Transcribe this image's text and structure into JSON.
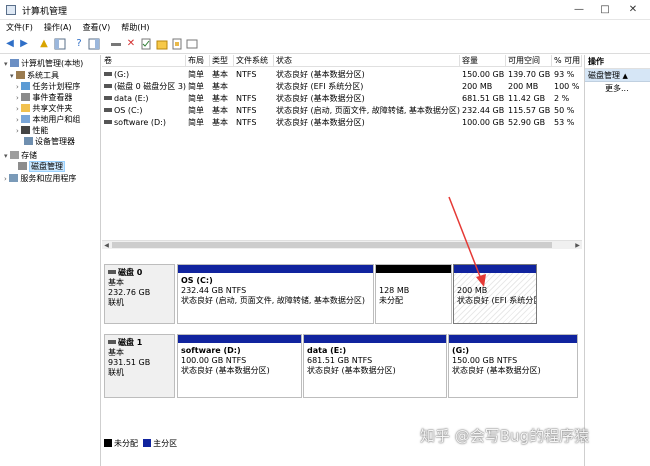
{
  "window": {
    "title": "计算机管理"
  },
  "menu": [
    "文件(F)",
    "操作(A)",
    "查看(V)",
    "帮助(H)"
  ],
  "tree": {
    "root": "计算机管理(本地)",
    "system_tools": "系统工具",
    "task_scheduler": "任务计划程序",
    "event_viewer": "事件查看器",
    "shared_folders": "共享文件夹",
    "local_users": "本地用户和组",
    "performance": "性能",
    "device_manager": "设备管理器",
    "storage": "存储",
    "disk_management": "磁盘管理",
    "services": "服务和应用程序"
  },
  "volumes": {
    "headers": [
      "卷",
      "布局",
      "类型",
      "文件系统",
      "状态",
      "容量",
      "可用空间",
      "% 可用"
    ],
    "rows": [
      [
        "(G:)",
        "简单",
        "基本",
        "NTFS",
        "状态良好 (基本数据分区)",
        "150.00 GB",
        "139.70 GB",
        "93 %"
      ],
      [
        "(磁盘 0 磁盘分区 3)",
        "简单",
        "基本",
        "",
        "状态良好 (EFI 系统分区)",
        "200 MB",
        "200 MB",
        "100 %"
      ],
      [
        "data (E:)",
        "简单",
        "基本",
        "NTFS",
        "状态良好 (基本数据分区)",
        "681.51 GB",
        "11.42 GB",
        "2 %"
      ],
      [
        "OS (C:)",
        "简单",
        "基本",
        "NTFS",
        "状态良好 (启动, 页面文件, 故障转储, 基本数据分区)",
        "232.44 GB",
        "115.57 GB",
        "50 %"
      ],
      [
        "software (D:)",
        "简单",
        "基本",
        "NTFS",
        "状态良好 (基本数据分区)",
        "100.00 GB",
        "52.90 GB",
        "53 %"
      ]
    ]
  },
  "disks": [
    {
      "name": "磁盘 0",
      "type": "基本",
      "size": "232.76 GB",
      "status": "联机",
      "partitions": [
        {
          "name": "OS  (C:)",
          "size": "232.44 GB NTFS",
          "status": "状态良好 (启动, 页面文件, 故障转储, 基本数据分区)"
        },
        {
          "name": "",
          "size": "128 MB",
          "status": "未分配"
        },
        {
          "name": "",
          "size": "200 MB",
          "status": "状态良好 (EFI 系统分区)"
        }
      ]
    },
    {
      "name": "磁盘 1",
      "type": "基本",
      "size": "931.51 GB",
      "status": "联机",
      "partitions": [
        {
          "name": "software  (D:)",
          "size": "100.00 GB NTFS",
          "status": "状态良好 (基本数据分区)"
        },
        {
          "name": "data  (E:)",
          "size": "681.51 GB NTFS",
          "status": "状态良好 (基本数据分区)"
        },
        {
          "name": "(G:)",
          "size": "150.00 GB NTFS",
          "status": "状态良好 (基本数据分区)"
        }
      ]
    }
  ],
  "legend": {
    "unallocated": "未分配",
    "primary": "主分区"
  },
  "actions": {
    "header": "操作",
    "section": "磁盘管理",
    "more": "更多..."
  },
  "watermark": "知乎 @会写Bug的程序猿",
  "colors": {
    "primary_bar": "#10239e",
    "unallocated_bar": "#000000",
    "arrow": "#e53935"
  }
}
